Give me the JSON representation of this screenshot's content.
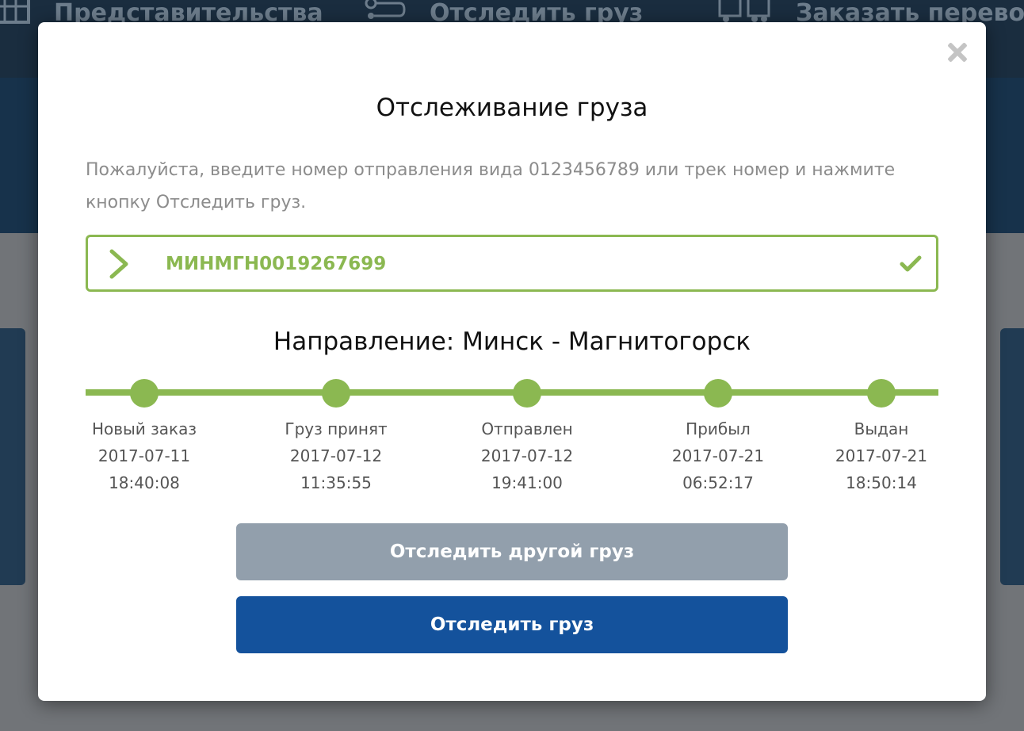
{
  "colors": {
    "accent_green": "#8bb851",
    "primary_blue": "#14529c",
    "secondary_gray": "#929fac",
    "nav_dark": "#1a2d3f"
  },
  "nav": {
    "items": [
      {
        "label": "Представительства",
        "icon": "grid-building-icon"
      },
      {
        "label": "Отследить груз",
        "icon": "route-icon"
      },
      {
        "label": "Заказать перевозку",
        "icon": "trucks-icon"
      }
    ]
  },
  "modal": {
    "title": "Отслеживание груза",
    "instructions": "Пожалуйста, введите номер отправления вида 0123456789 или трек номер и нажмите кнопку Отследить груз.",
    "tracking_number": "МИНМГН0019267699",
    "direction_label": "Направление:",
    "direction_route": "Минск - Магнитогорск",
    "stages": [
      {
        "name": "Новый заказ",
        "date": "2017-07-11",
        "time": "18:40:08"
      },
      {
        "name": "Груз принят",
        "date": "2017-07-12",
        "time": "11:35:55"
      },
      {
        "name": "Отправлен",
        "date": "2017-07-12",
        "time": "19:41:00"
      },
      {
        "name": "Прибыл",
        "date": "2017-07-21",
        "time": "06:52:17"
      },
      {
        "name": "Выдан",
        "date": "2017-07-21",
        "time": "18:50:14"
      }
    ],
    "track_other_button": "Отследить другой груз",
    "track_button": "Отследить груз"
  }
}
